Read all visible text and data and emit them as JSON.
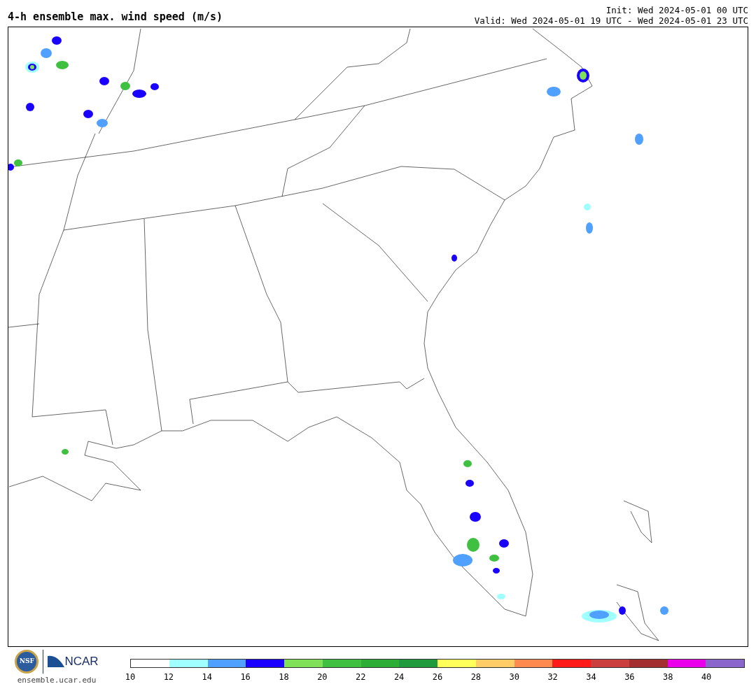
{
  "title": "4-h ensemble max. wind speed (m/s)",
  "init": "Init: Wed 2024-05-01 00 UTC",
  "valid": "Valid: Wed 2024-05-01 19 UTC - Wed 2024-05-01 23 UTC",
  "footer": {
    "logo_left": "NSF",
    "logo_right": "NCAR",
    "website": "ensemble.ucar.edu"
  },
  "colorbar": {
    "bins": [
      {
        "color": "#ffffff"
      },
      {
        "color": "#a0ffff"
      },
      {
        "color": "#50a0ff"
      },
      {
        "color": "#1a00ff"
      },
      {
        "color": "#80e058"
      },
      {
        "color": "#40c040"
      },
      {
        "color": "#2cae36"
      },
      {
        "color": "#1f9a3c"
      },
      {
        "color": "#ffff5c"
      },
      {
        "color": "#ffcc66"
      },
      {
        "color": "#ff8a50"
      },
      {
        "color": "#ff1a1a"
      },
      {
        "color": "#cc3f3f"
      },
      {
        "color": "#a32f2f"
      },
      {
        "color": "#ea00ea"
      },
      {
        "color": "#8a66cc"
      }
    ],
    "ticks": [
      "10",
      "12",
      "14",
      "16",
      "18",
      "20",
      "22",
      "24",
      "26",
      "28",
      "30",
      "32",
      "34",
      "36",
      "38",
      "40"
    ]
  }
}
